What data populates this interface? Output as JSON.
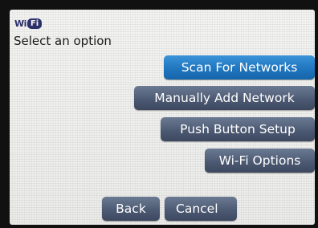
{
  "header": {
    "logo_wi": "Wi",
    "logo_fi": "Fi",
    "prompt": "Select an option"
  },
  "menu": {
    "scan_label": "Scan For Networks",
    "manual_label": "Manually Add Network",
    "push_label": "Push Button Setup",
    "wifi_options_label": "Wi-Fi Options"
  },
  "footer": {
    "back_label": "Back",
    "cancel_label": "Cancel"
  },
  "colors": {
    "selected_button": "#2a82c8",
    "default_button": "#4f5c75",
    "background": "#f0f0ee",
    "logo": "#2b2f6a"
  }
}
